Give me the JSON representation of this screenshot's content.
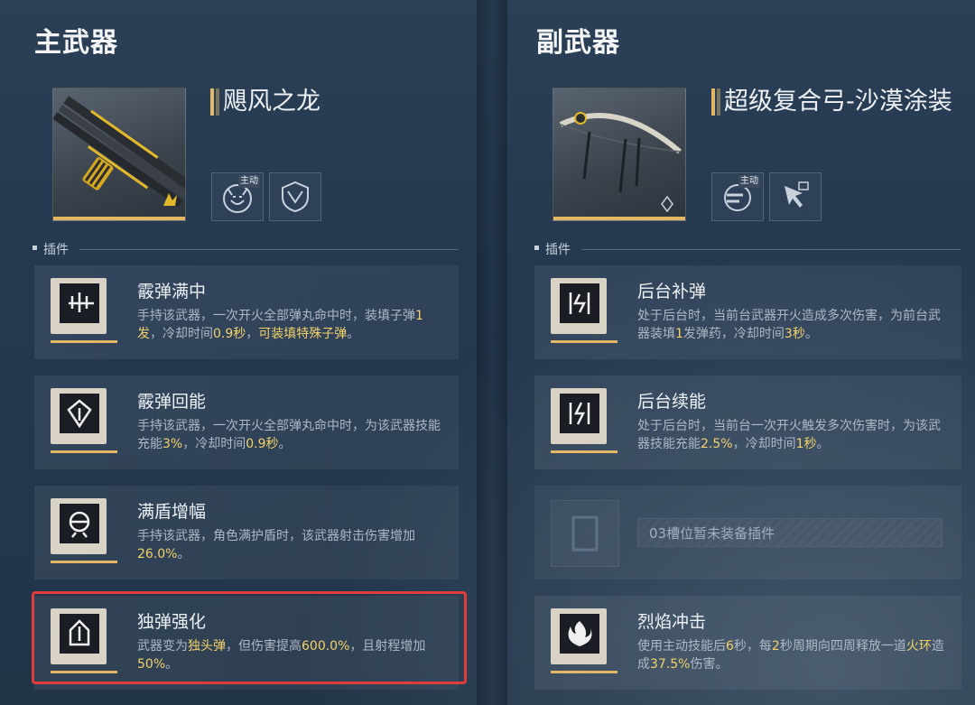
{
  "primary": {
    "title": "主武器",
    "weapon_name": "飓风之龙",
    "skill_tag": "主动",
    "section_label": "插件",
    "plugins": [
      {
        "name": "霰弹满中",
        "desc": [
          {
            "t": "手持该武器，一次开火全部弹丸命中时，装填子弹"
          },
          {
            "t": "1发",
            "h": true
          },
          {
            "t": "，冷却时间"
          },
          {
            "t": "0.9秒",
            "h": true
          },
          {
            "t": "，"
          },
          {
            "t": "可装填特殊子弹",
            "h": true
          },
          {
            "t": "。"
          }
        ]
      },
      {
        "name": "霰弹回能",
        "desc": [
          {
            "t": "手持该武器，一次开火全部弹丸命中时，为该武器技能充能"
          },
          {
            "t": "3%",
            "h": true
          },
          {
            "t": "，冷却时间"
          },
          {
            "t": "0.9秒",
            "h": true
          },
          {
            "t": "。"
          }
        ]
      },
      {
        "name": "满盾增幅",
        "desc": [
          {
            "t": "手持该武器，角色满护盾时，该武器射击伤害增加"
          },
          {
            "t": "26.0%",
            "h": true
          },
          {
            "t": "。"
          }
        ]
      },
      {
        "name": "独弹强化",
        "desc": [
          {
            "t": "武器变为"
          },
          {
            "t": "独头弹",
            "h": true
          },
          {
            "t": "，但伤害提高"
          },
          {
            "t": "600.0%",
            "h": true
          },
          {
            "t": "，且射程增加"
          },
          {
            "t": "50%",
            "h": true
          },
          {
            "t": "。"
          }
        ]
      }
    ]
  },
  "secondary": {
    "title": "副武器",
    "weapon_name": "超级复合弓-沙漠涂装",
    "skill_tag": "主动",
    "section_label": "插件",
    "plugins": [
      {
        "name": "后台补弹",
        "desc": [
          {
            "t": "处于后台时，当前台武器开火造成多次伤害，为前台武器装填"
          },
          {
            "t": "1",
            "h": true
          },
          {
            "t": "发弹药，冷却时间"
          },
          {
            "t": "3秒",
            "h": true
          },
          {
            "t": "。"
          }
        ]
      },
      {
        "name": "后台续能",
        "desc": [
          {
            "t": "处于后台时，当前台一次开火触发多次伤害时，为该武器技能充能"
          },
          {
            "t": "2.5%",
            "h": true
          },
          {
            "t": "，冷却时间"
          },
          {
            "t": "1秒",
            "h": true
          },
          {
            "t": "。"
          }
        ]
      },
      {
        "empty": true,
        "text": "03槽位暂未装备插件"
      },
      {
        "name": "烈焰冲击",
        "desc": [
          {
            "t": "使用主动技能后"
          },
          {
            "t": "6",
            "h": true
          },
          {
            "t": "秒，每"
          },
          {
            "t": "2",
            "h": true
          },
          {
            "t": "秒周期向四周释放一道"
          },
          {
            "t": "火环",
            "h": true
          },
          {
            "t": "造成"
          },
          {
            "t": "37.5%",
            "h": true
          },
          {
            "t": "伤害。"
          }
        ]
      }
    ]
  },
  "colors": {
    "highlight": "#f2d26a",
    "accent": "#e2b865",
    "callout_box": "#e23b3b"
  }
}
